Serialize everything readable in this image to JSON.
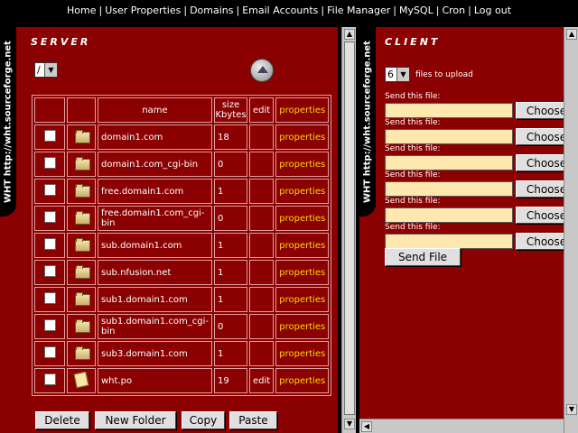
{
  "nav": {
    "links": [
      "Home",
      "User Properties",
      "Domains",
      "Email Accounts",
      "File Manager",
      "MySQL",
      "Cron",
      "Log out"
    ]
  },
  "brand": "WHT   http://wht.sourceforge.net",
  "server": {
    "title": "SERVER",
    "path_select": "/",
    "headers": {
      "name": "name",
      "size": "size Kbytes",
      "edit": "edit",
      "properties": "properties"
    },
    "rows": [
      {
        "name": "domain1.com",
        "size": "18",
        "edit": "",
        "props": "properties",
        "type": "folder"
      },
      {
        "name": "domain1.com_cgi-bin",
        "size": "0",
        "edit": "",
        "props": "properties",
        "type": "folder"
      },
      {
        "name": "free.domain1.com",
        "size": "1",
        "edit": "",
        "props": "properties",
        "type": "folder"
      },
      {
        "name": "free.domain1.com_cgi-bin",
        "size": "0",
        "edit": "",
        "props": "properties",
        "type": "folder"
      },
      {
        "name": "sub.domain1.com",
        "size": "1",
        "edit": "",
        "props": "properties",
        "type": "folder"
      },
      {
        "name": "sub.nfusion.net",
        "size": "1",
        "edit": "",
        "props": "properties",
        "type": "folder"
      },
      {
        "name": "sub1.domain1.com",
        "size": "1",
        "edit": "",
        "props": "properties",
        "type": "folder"
      },
      {
        "name": "sub1.domain1.com_cgi-bin",
        "size": "0",
        "edit": "",
        "props": "properties",
        "type": "folder"
      },
      {
        "name": "sub3.domain1.com",
        "size": "1",
        "edit": "",
        "props": "properties",
        "type": "folder"
      },
      {
        "name": "wht.po",
        "size": "19",
        "edit": "edit",
        "props": "properties",
        "type": "file"
      }
    ],
    "buttons": {
      "delete": "Delete",
      "new_folder": "New Folder",
      "copy": "Copy",
      "paste": "Paste"
    }
  },
  "client": {
    "title": "CLIENT",
    "files_count": "6",
    "files_label": "files to upload",
    "send_label": "Send this file:",
    "choose_label": "Choose",
    "send_button": "Send File",
    "fields": [
      "",
      "",
      "",
      "",
      "",
      ""
    ]
  },
  "colors": {
    "panel": "#8b0000",
    "accent_link": "#ffd700",
    "input_bg": "#ffe8b0"
  }
}
